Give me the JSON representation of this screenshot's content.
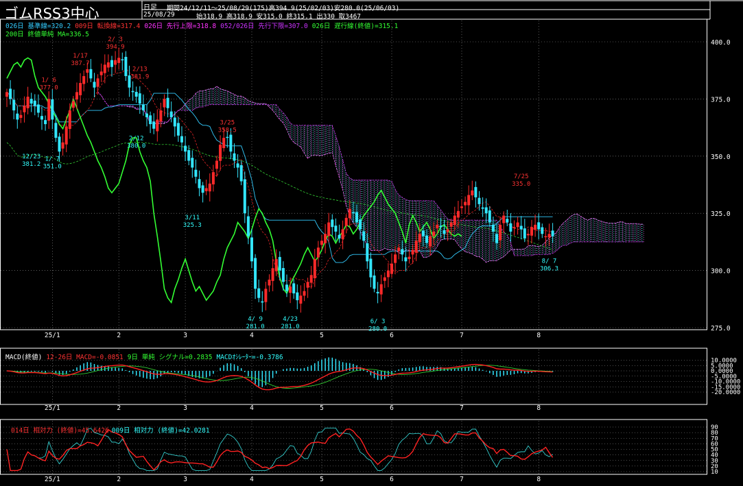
{
  "header": {
    "title": "ゴムRSS3中心",
    "period_type": "日足",
    "range_text": "期間24/12/11～25/08/29(175)高394.9(25/02/03)安280.0(25/06/03)",
    "date": "25/08/29",
    "ohlc_text": "始318.9 高318.9 安315.0 終315.1 出330 取3467"
  },
  "legends": {
    "main": [
      {
        "text": "026日 基準線=320.2",
        "color": "#33ccff"
      },
      {
        "text": "009日 転換線=317.4",
        "color": "#ff3333"
      },
      {
        "text": "026日 先行上限=318.8",
        "color": "#ff33ff"
      },
      {
        "text": "052/026日 先行下限=307.0",
        "color": "#cc33ff"
      },
      {
        "text": "026日 遅行線(終値)=315.1",
        "color": "#33ff33"
      }
    ],
    "main2": {
      "text": "200日 終値単純 MA=336.5",
      "color": "#33ff33"
    },
    "macd": [
      {
        "text": "MACD(終値)",
        "color": "#ffffff"
      },
      {
        "text": "12-26日 MACD=-0.0851",
        "color": "#ff3333"
      },
      {
        "text": "9日 単純 シグナル=0.2835",
        "color": "#33ff33"
      },
      {
        "text": "MACDｵｼﾚｰﾀｰ=-0.3786",
        "color": "#33ffff"
      }
    ],
    "rsi": [
      {
        "text": "014日 相対力 (終値)=45.6426",
        "color": "#ff3333"
      },
      {
        "text": "009日 相対力 (終値)=42.0281",
        "color": "#33ffff"
      }
    ]
  },
  "colors": {
    "up": "#ff2a2a",
    "down": "#33e6ff",
    "grid": "#9a9a9a"
  },
  "chart_data": [
    {
      "type": "candlestick",
      "y_ticks": [
        "400.0",
        "375.0",
        "350.0",
        "325.0",
        "300.0",
        "275.0"
      ],
      "ylim": [
        275,
        400
      ],
      "x_ticks": [
        "25/1",
        "2",
        "3",
        "4",
        "5",
        "6",
        "7",
        "8"
      ],
      "annotations": [
        {
          "lines": [
            "1/ 6",
            "377.0"
          ],
          "i": 12,
          "v": 377.0,
          "pos": "above",
          "color": "#ff3333"
        },
        {
          "lines": [
            "1/17",
            "387.7"
          ],
          "i": 21,
          "v": 387.7,
          "pos": "above",
          "color": "#ff3333"
        },
        {
          "lines": [
            "2/ 3",
            "394.9"
          ],
          "i": 31,
          "v": 394.9,
          "pos": "above",
          "color": "#ff3333"
        },
        {
          "lines": [
            "2/13",
            "381.9"
          ],
          "i": 38,
          "v": 381.9,
          "pos": "above",
          "color": "#ff3333"
        },
        {
          "lines": [
            "3/25",
            "358.5"
          ],
          "i": 63,
          "v": 358.5,
          "pos": "above",
          "color": "#ff3333"
        },
        {
          "lines": [
            "7/25",
            "335.0"
          ],
          "i": 147,
          "v": 335.0,
          "pos": "above",
          "color": "#ff3333"
        },
        {
          "lines": [
            "12/23",
            "381.2"
          ],
          "i": 7,
          "v": 352.0,
          "pos": "below",
          "color": "#33ffff"
        },
        {
          "lines": [
            "1/ 7",
            "351.0"
          ],
          "i": 13,
          "v": 351.0,
          "pos": "below",
          "color": "#33ffff"
        },
        {
          "lines": [
            "2/12",
            "380.0"
          ],
          "i": 37,
          "v": 360.0,
          "pos": "below",
          "color": "#33ffff"
        },
        {
          "lines": [
            "3/11",
            "325.3"
          ],
          "i": 53,
          "v": 325.3,
          "pos": "below",
          "color": "#33ffff"
        },
        {
          "lines": [
            "4/ 9",
            "281.0"
          ],
          "i": 71,
          "v": 281.0,
          "pos": "below",
          "color": "#33ffff"
        },
        {
          "lines": [
            "4/23",
            "281.0"
          ],
          "i": 81,
          "v": 281.0,
          "pos": "below",
          "color": "#33ffff"
        },
        {
          "lines": [
            "6/ 3",
            "280.0"
          ],
          "i": 106,
          "v": 280.0,
          "pos": "below",
          "color": "#33ffff"
        },
        {
          "lines": [
            "8/ 7",
            "306.3"
          ],
          "i": 155,
          "v": 306.3,
          "pos": "below",
          "color": "#33ffff"
        }
      ],
      "closes": [
        378,
        375,
        370,
        366,
        368,
        372,
        376,
        373,
        372,
        369,
        366,
        364,
        375,
        366,
        358,
        352,
        356,
        363,
        370,
        374,
        378,
        382,
        385,
        388,
        384,
        380,
        384,
        387,
        390,
        391,
        389,
        392,
        393,
        392,
        385,
        380,
        378,
        376,
        373,
        370,
        367,
        364,
        362,
        366,
        370,
        375,
        371,
        367,
        363,
        359,
        356,
        352,
        348,
        345,
        341,
        336,
        334,
        336,
        338,
        343,
        348,
        355,
        358,
        358,
        352,
        348,
        345,
        339,
        325,
        315,
        304,
        292,
        288,
        286,
        292,
        296,
        301,
        305,
        300,
        295,
        291,
        293,
        290,
        287,
        289,
        291,
        295,
        298,
        305,
        310,
        313,
        316,
        321,
        319,
        317,
        314,
        318,
        323,
        327,
        325,
        321,
        318,
        313,
        304,
        297,
        292,
        290,
        294,
        297,
        300,
        303,
        307,
        310,
        307,
        304,
        306,
        309,
        313,
        316,
        315,
        312,
        315,
        317,
        320,
        319,
        316,
        318,
        321,
        324,
        326,
        328,
        330,
        333,
        335,
        332,
        329,
        327,
        325,
        321,
        317,
        312,
        320,
        324,
        321,
        317,
        319,
        321,
        318,
        314,
        316,
        319,
        320,
        318,
        316,
        315,
        316,
        315
      ]
    },
    {
      "type": "line",
      "title": "MACD(終値)",
      "y_ticks": [
        "10.0000",
        "5.0000",
        "0.0000",
        "-5.0000",
        "-10.0000",
        "-15.0000",
        "-20.0000"
      ],
      "ylim": [
        -20,
        10
      ]
    },
    {
      "type": "line",
      "title": "相対力",
      "y_ticks": [
        "90",
        "80",
        "70",
        "60",
        "50",
        "40",
        "30",
        "20",
        "10"
      ],
      "ylim": [
        10,
        90
      ]
    }
  ]
}
